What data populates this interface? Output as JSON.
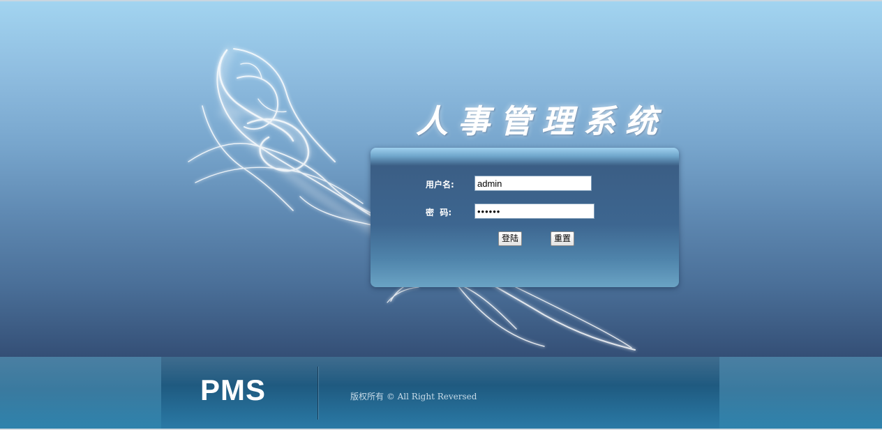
{
  "app_title": "人事管理系统",
  "login": {
    "username_label": "用户名:",
    "username_value": "admin",
    "password_label": "密  码:",
    "password_value": "••••••",
    "login_button": "登陆",
    "reset_button": "重置"
  },
  "footer": {
    "logo": "PMS",
    "copyright": "版权所有 © All Right Reversed"
  },
  "colors": {
    "sky_top": "#a2d4f0",
    "sky_bottom": "#344f76",
    "panel": "#3d6690",
    "footer": "#1f5a80"
  }
}
